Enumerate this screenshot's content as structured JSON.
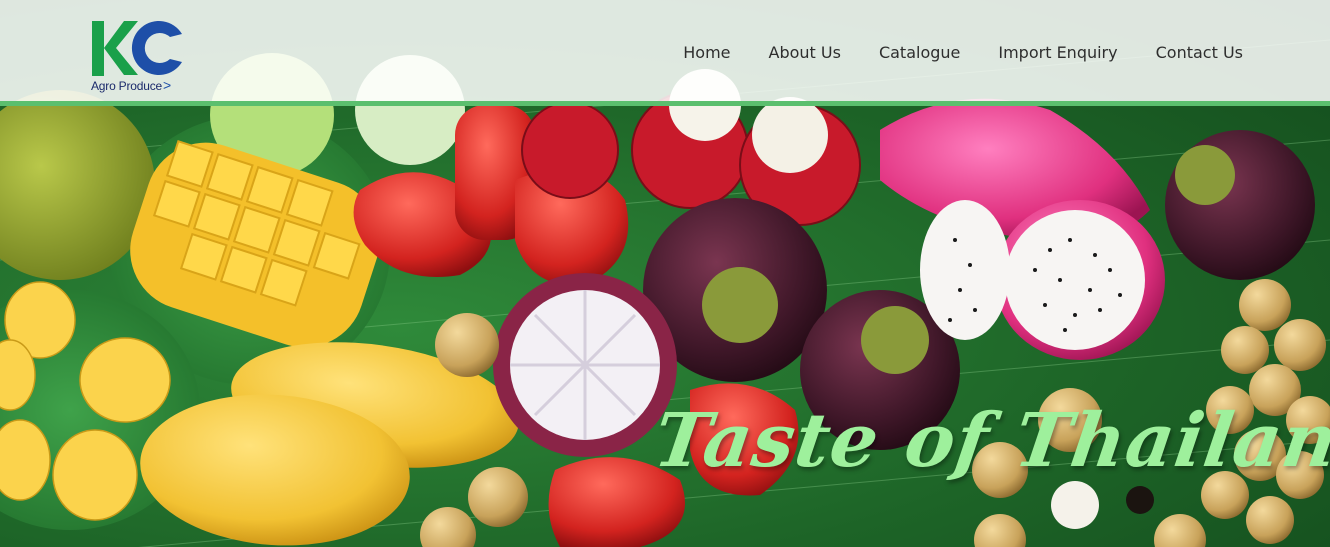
{
  "brand": {
    "logo_letters": "KC",
    "caption": "Agro Produce",
    "caption_chevron": ">",
    "colors": {
      "green": "#1aa04a",
      "blue": "#1e4fa8",
      "navy": "#1b2a6b",
      "accent_bar": "#5bbf6e"
    }
  },
  "nav": {
    "items": [
      {
        "label": "Home"
      },
      {
        "label": "About Us"
      },
      {
        "label": "Catalogue"
      },
      {
        "label": "Import Enquiry"
      },
      {
        "label": "Contact Us"
      }
    ]
  },
  "hero": {
    "tagline": "Taste of Thailand",
    "tagline_color": "#9ef09c",
    "image_subject": "tropical-fruits-on-banana-leaf"
  }
}
